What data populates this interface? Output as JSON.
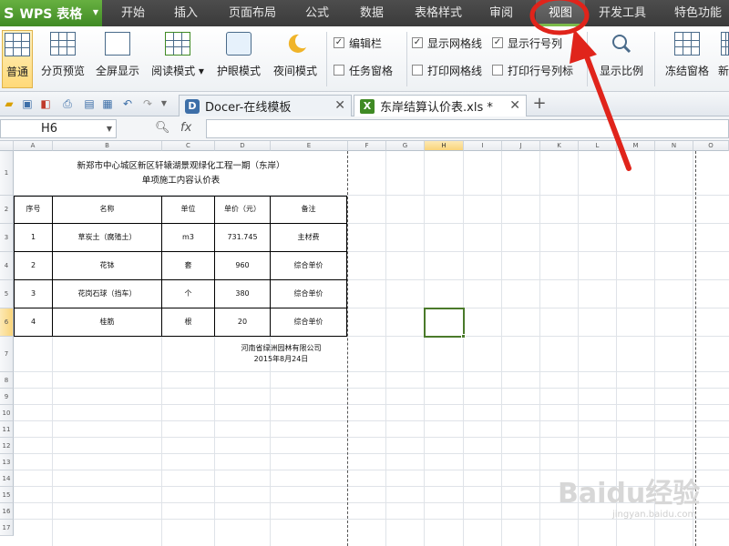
{
  "app": {
    "name": "WPS 表格",
    "logo_letter": "S"
  },
  "menu": {
    "tabs": [
      "开始",
      "插入",
      "页面布局",
      "公式",
      "数据",
      "表格样式",
      "审阅",
      "视图",
      "开发工具",
      "特色功能"
    ],
    "active_tab": "视图"
  },
  "ribbon": {
    "buttons": [
      "普通",
      "分页预览",
      "全屏显示",
      "阅读模式",
      "护眼模式",
      "夜间模式"
    ],
    "selected_button": "普通",
    "checkboxes": [
      {
        "label": "编辑栏",
        "checked": true
      },
      {
        "label": "任务窗格",
        "checked": false
      },
      {
        "label": "显示网格线",
        "checked": true
      },
      {
        "label": "打印网格线",
        "checked": false
      },
      {
        "label": "显示行号列",
        "checked": true
      },
      {
        "label": "打印行号列标",
        "checked": false
      }
    ],
    "zoom_label": "显示比例",
    "freeze_label": "冻结窗格",
    "partial_label": "新"
  },
  "doc_tabs": [
    {
      "title": "Docer-在线模板",
      "active": false
    },
    {
      "title": "东岸结算认价表.xls *",
      "active": true
    }
  ],
  "formula_bar": {
    "cell_ref": "H6",
    "fx_label": "fx",
    "value": ""
  },
  "sheet": {
    "columns": [
      "A",
      "B",
      "C",
      "D",
      "E",
      "F",
      "G",
      "H",
      "I",
      "J",
      "K",
      "L",
      "M",
      "N",
      "O"
    ],
    "active_column": "H",
    "rows": [
      "1",
      "2",
      "3",
      "4",
      "5",
      "6",
      "7",
      "8",
      "9",
      "10",
      "11",
      "12",
      "13",
      "14",
      "15",
      "16",
      "17"
    ],
    "active_row": "6",
    "title_line1": "新郑市中心城区新区轩辕湖景观绿化工程一期（东岸）",
    "title_line2": "单项施工内容认价表",
    "headers": [
      "序号",
      "名称",
      "单位",
      "单价（元）",
      "备注"
    ],
    "data_rows": [
      [
        "1",
        "草炭土（腐殖土）",
        "m3",
        "731.745",
        "主材费"
      ],
      [
        "2",
        "花钵",
        "套",
        "960",
        "综合单价"
      ],
      [
        "3",
        "花岗石球（挡车）",
        "个",
        "380",
        "综合单价"
      ],
      [
        "4",
        "桂筋",
        "根",
        "20",
        "综合单价"
      ]
    ],
    "footer_company": "河南省绿洲园林有限公司",
    "footer_date": "2015年8月24日"
  },
  "watermark": {
    "brand": "Baidu经验",
    "url": "jingyan.baidu.com"
  },
  "colors": {
    "accent_green": "#5ea83a",
    "annotation_red": "#e0241b",
    "selection_green": "#4a7a2a"
  }
}
